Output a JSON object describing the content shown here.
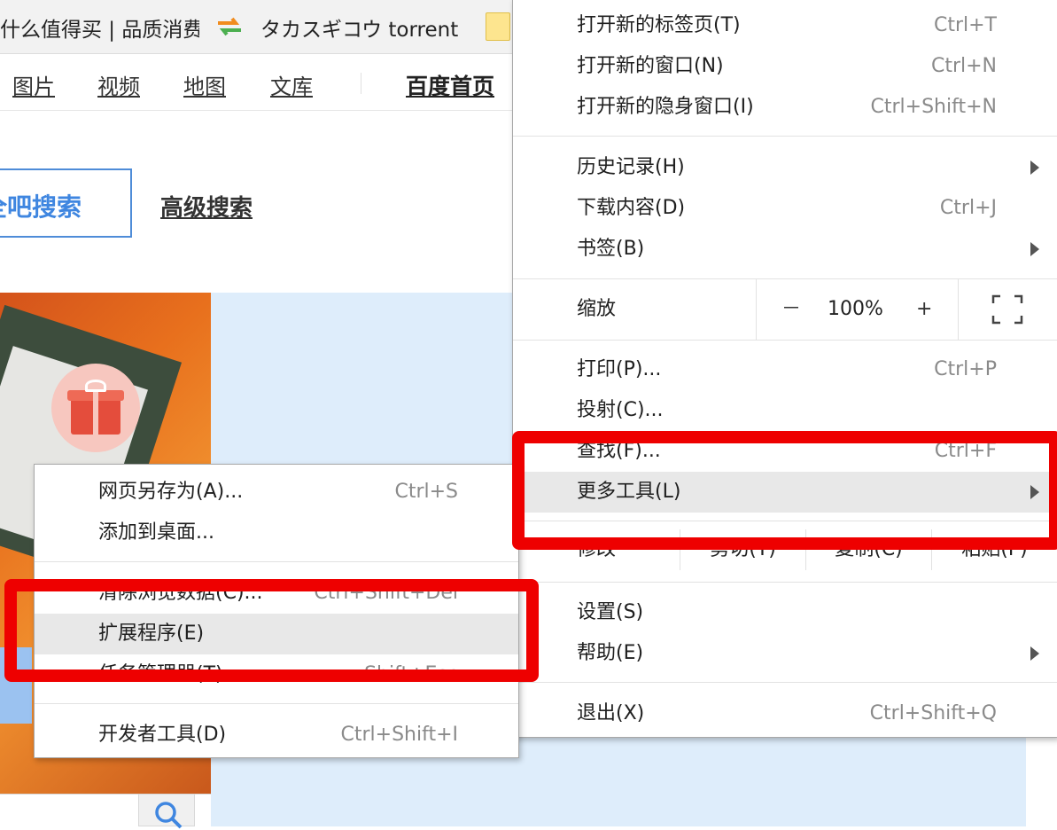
{
  "bookmarks": [
    {
      "label": "什么值得买 | 品质消费",
      "icon": "page-icon"
    },
    {
      "label": "タカスギコウ torrent",
      "icon": "orange-green-arrows-icon"
    },
    {
      "label": "",
      "icon": "folder-icon"
    }
  ],
  "nav": {
    "links": [
      "图片",
      "视频",
      "地图",
      "文库"
    ],
    "home": "百度首页"
  },
  "search": {
    "button_label": "全吧搜索",
    "advanced": "高级搜索"
  },
  "main_menu": {
    "items": [
      {
        "label": "打开新的标签页(T)",
        "shortcut": "Ctrl+T"
      },
      {
        "label": "打开新的窗口(N)",
        "shortcut": "Ctrl+N"
      },
      {
        "label": "打开新的隐身窗口(I)",
        "shortcut": "Ctrl+Shift+N"
      },
      {
        "label": "历史记录(H)",
        "shortcut": ""
      },
      {
        "label": "下载内容(D)",
        "shortcut": "Ctrl+J"
      },
      {
        "label": "书签(B)",
        "shortcut": ""
      },
      {
        "label": "打印(P)...",
        "shortcut": "Ctrl+P"
      },
      {
        "label": "投射(C)...",
        "shortcut": ""
      },
      {
        "label": "查找(F)...",
        "shortcut": "Ctrl+F"
      },
      {
        "label": "更多工具(L)",
        "shortcut": ""
      },
      {
        "label": "设置(S)",
        "shortcut": ""
      },
      {
        "label": "帮助(E)",
        "shortcut": ""
      },
      {
        "label": "退出(X)",
        "shortcut": "Ctrl+Shift+Q"
      }
    ],
    "zoom": {
      "label": "缩放",
      "minus": "－",
      "value": "100%",
      "plus": "+"
    },
    "edit": {
      "label": "修改",
      "cut": "剪切(T)",
      "copy": "复制(C)",
      "paste": "粘贴(P)"
    }
  },
  "sub_menu": {
    "items": [
      {
        "label": "网页另存为(A)...",
        "shortcut": "Ctrl+S"
      },
      {
        "label": "添加到桌面...",
        "shortcut": ""
      },
      {
        "label": "清除浏览数据(C)...",
        "shortcut": "Ctrl+Shift+Del"
      },
      {
        "label": "扩展程序(E)",
        "shortcut": ""
      },
      {
        "label": "任务管理器(T)",
        "shortcut": "Shift+Esc"
      },
      {
        "label": "开发者工具(D)",
        "shortcut": "Ctrl+Shift+I"
      }
    ]
  },
  "colors": {
    "highlight": "#e8e8e8",
    "annotation_red": "#ee0000",
    "link_blue": "#3f86e0",
    "page_light_blue": "#deedfb"
  }
}
